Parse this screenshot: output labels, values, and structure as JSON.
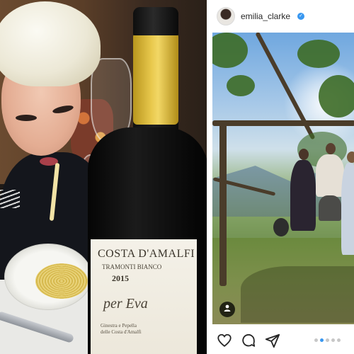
{
  "left_photo": {
    "bottle_label": {
      "brand": "COSTA D'AMALFI",
      "appellation": "TRAMONTI BIANCO",
      "vintage": "2015",
      "name": "per Eva",
      "fine_print": "Ginestra e Pepella\ndelle Costa d'Amalfi"
    }
  },
  "instagram": {
    "username": "emilia_clarke",
    "verified": true,
    "carousel": {
      "total": 5,
      "active_index": 2
    },
    "icons": {
      "like": "heart-icon",
      "comment": "comment-icon",
      "share": "send-icon",
      "user_tag": "person-tag-icon",
      "verified": "verified-badge-icon"
    },
    "colors": {
      "verified": "#3897f0",
      "active_dot": "#3897f0",
      "inactive_dot": "#c7c7c7"
    }
  }
}
